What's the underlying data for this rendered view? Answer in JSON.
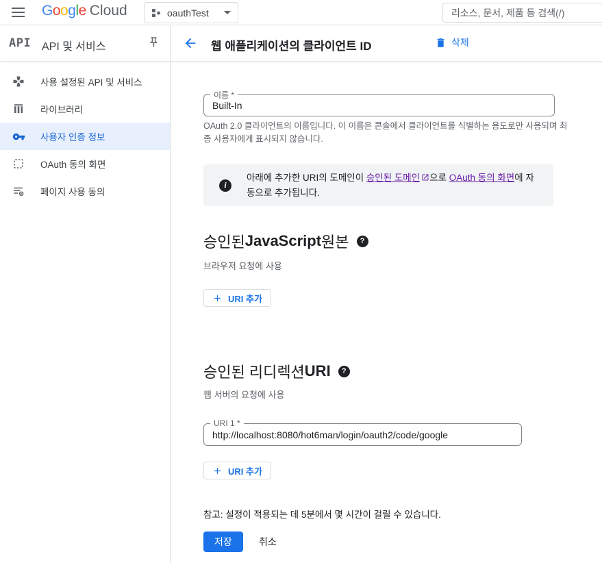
{
  "topbar": {
    "logo": {
      "letters": [
        "G",
        "o",
        "o",
        "g",
        "l",
        "e"
      ],
      "cloud": "Cloud"
    },
    "project": {
      "name": "oauthTest"
    },
    "search": {
      "placeholder": "리소스, 문서, 제품 등 검색(/)"
    }
  },
  "sidebar": {
    "logo": "API",
    "title": "API 및 서비스",
    "items": [
      {
        "label": "사용 설정된 API 및 서비스"
      },
      {
        "label": "라이브러리"
      },
      {
        "label": "사용자 인증 정보"
      },
      {
        "label": "OAuth 동의 화면"
      },
      {
        "label": "페이지 사용 동의"
      }
    ]
  },
  "header": {
    "title": "웹 애플리케이션의 클라이언트 ID",
    "delete_label": "삭제"
  },
  "form": {
    "name_field": {
      "label": "이름 *",
      "value": "Built-In",
      "helper": "OAuth 2.0 클라이언트의 이름입니다. 이 이름은 콘솔에서 클라이언트를 식별하는 용도로만 사용되며 최종 사용자에게 표시되지 않습니다."
    },
    "banner": {
      "text1": "아래에 추가한 URI의 도메인이 ",
      "link1": "승인된 도메인",
      "text2": "으로 ",
      "link2": "OAuth 동의 화면",
      "text3": "에 자동으로 추가됩니다."
    },
    "origins_section": {
      "title_pre": "승인된 ",
      "title_strong": "JavaScript",
      "title_post": " 원본",
      "subtitle": "브라우저 요청에 사용",
      "add_button": "URI 추가"
    },
    "redirect_section": {
      "title_pre": "승인된 리디렉션 ",
      "title_strong": "URI",
      "title_post": "",
      "subtitle": "웹 서버의 요청에 사용",
      "add_button": "URI 추가",
      "uri_field": {
        "label": "URI 1 *",
        "value": "http://localhost:8080/hot6man/login/oauth2/code/google"
      }
    },
    "note": "참고: 설정이 적용되는 데 5분에서 몇 시간이 걸릴 수 있습니다.",
    "save_label": "저장",
    "cancel_label": "취소"
  },
  "colors": {
    "accent_blue": "#1a73e8",
    "selected_blue": "#1967d2",
    "selected_bg": "#e8f0fe",
    "link_purple": "#681da8",
    "banner_bg": "#f1f3f4",
    "border_gray": "#dadce0"
  }
}
